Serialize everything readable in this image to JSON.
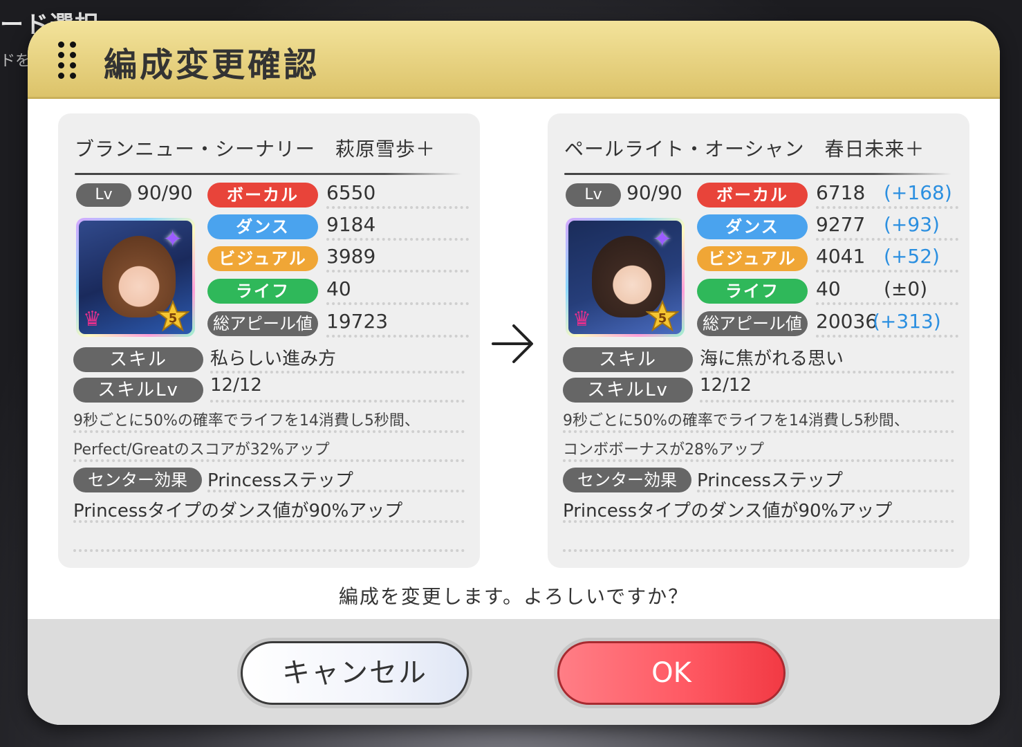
{
  "background": {
    "title": "ード選択",
    "subtitle": "ドを"
  },
  "dialog": {
    "title": "編成変更確認",
    "confirm_text": "編成を変更します。よろしいですか？",
    "cancel_label": "キャンセル",
    "ok_label": "OK"
  },
  "labels": {
    "lv": "Lv",
    "vocal": "ボーカル",
    "dance": "ダンス",
    "visual": "ビジュアル",
    "life": "ライフ",
    "total": "総アピール値",
    "skill": "スキル",
    "skill_lv": "スキルLv",
    "center": "センター効果"
  },
  "before": {
    "card_name": "ブランニュー・シーナリー　萩原雪歩＋",
    "level": "90/90",
    "rarity": "5",
    "vocal": "6550",
    "dance": "9184",
    "visual": "3989",
    "life": "40",
    "total": "19723",
    "skill_name": "私らしい進み方",
    "skill_lv": "12/12",
    "skill_desc_1": "9秒ごとに50%の確率でライフを14消費し5秒間、",
    "skill_desc_2": "Perfect/Greatのスコアが32%アップ",
    "center_name": "Princessステップ",
    "center_desc": "Princessタイプのダンス値が90%アップ"
  },
  "after": {
    "card_name": "ペールライト・オーシャン　春日未来＋",
    "level": "90/90",
    "rarity": "5",
    "vocal": "6718",
    "vocal_diff": "(+168)",
    "dance": "9277",
    "dance_diff": "(+93)",
    "visual": "4041",
    "visual_diff": "(+52)",
    "life": "40",
    "life_diff": "(±0)",
    "total": "20036",
    "total_diff": "(+313)",
    "skill_name": "海に焦がれる思い",
    "skill_lv": "12/12",
    "skill_desc_1": "9秒ごとに50%の確率でライフを14消費し5秒間、",
    "skill_desc_2": "コンボボーナスが28%アップ",
    "center_name": "Princessステップ",
    "center_desc": "Princessタイプのダンス値が90%アップ"
  },
  "colors": {
    "vocal": "#e8443a",
    "dance": "#4aa3ee",
    "visual": "#f0a636",
    "life": "#2fb85a",
    "diff_blue": "#2b8fe0",
    "header_gold": "#dcc36a",
    "ok_red": "#ff5a64"
  },
  "icons": {
    "arrow": "right-arrow-icon",
    "crown": "crown-icon",
    "star": "star-rank-icon",
    "sparkle": "sparkle-icon",
    "menu": "drag-dots-icon"
  }
}
